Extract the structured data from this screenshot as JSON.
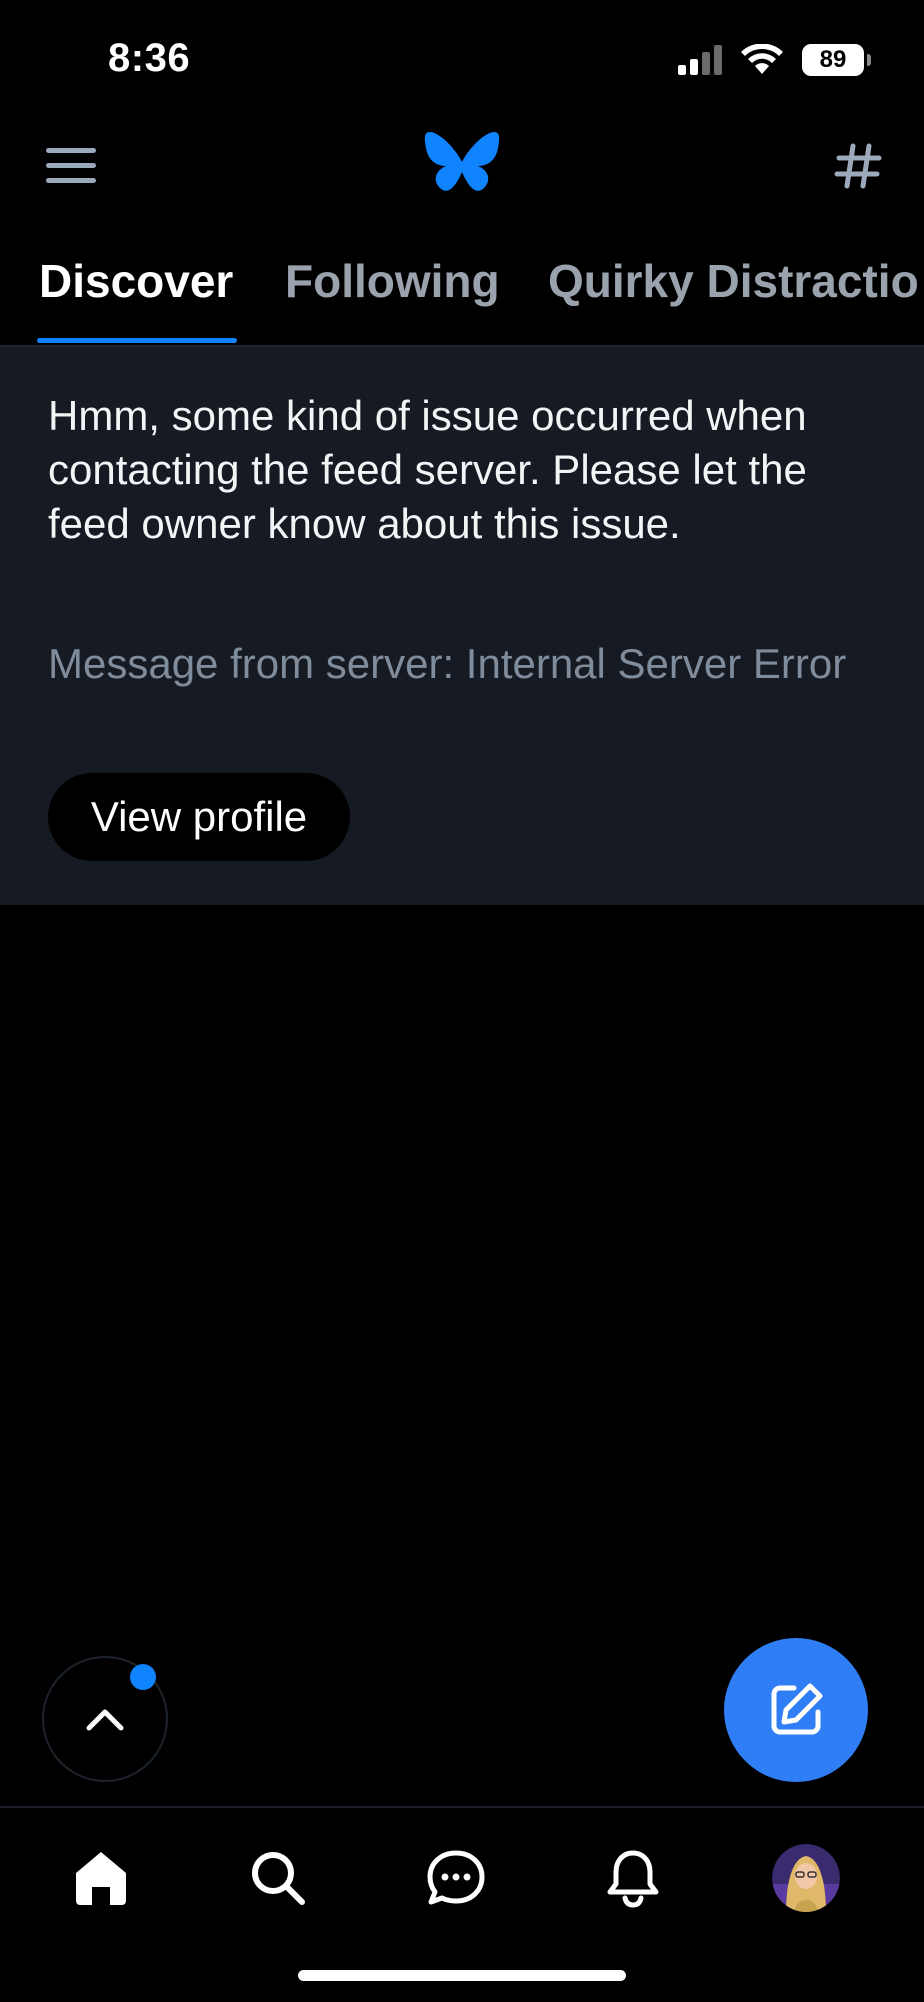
{
  "status_bar": {
    "time": "8:36",
    "battery": "89",
    "icons": [
      "signal-icon",
      "wifi-icon",
      "battery-icon"
    ]
  },
  "header": {
    "menu_icon": "hamburger-menu-icon",
    "logo_icon": "butterfly-logo-icon",
    "feeds_icon": "hash-icon"
  },
  "tabs": [
    {
      "label": "Discover",
      "active": true
    },
    {
      "label": "Following",
      "active": false
    },
    {
      "label": "Quirky Distractio",
      "active": false
    }
  ],
  "error": {
    "message": "Hmm, some kind of issue occurred when contacting the feed server. Please let the feed owner know about this issue.",
    "server_message": "Message from server: Internal Server Error",
    "button_label": "View profile"
  },
  "floating": {
    "scroll_top_icon": "chevron-up-icon",
    "compose_icon": "compose-icon"
  },
  "bottom_nav": {
    "items": [
      "home-icon",
      "search-icon",
      "chat-icon",
      "bell-icon",
      "avatar"
    ]
  },
  "colors": {
    "accent": "#1083fe",
    "panel_bg": "#161b23",
    "muted_text": "#7f8c9c",
    "fab": "#2f7ef6"
  }
}
